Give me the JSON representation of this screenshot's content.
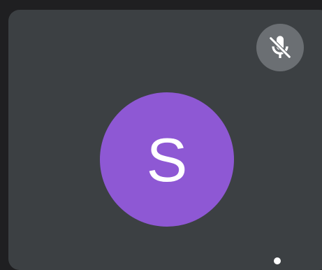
{
  "participant_tile": {
    "avatar": {
      "initial": "S",
      "color": "#8e58d4"
    },
    "name": "",
    "mute_badge": {
      "icon": "mic-off-icon",
      "color": "#6b6f73"
    },
    "more_button": {
      "icon": "more-vert-icon"
    },
    "background_color": "#3c4043"
  }
}
